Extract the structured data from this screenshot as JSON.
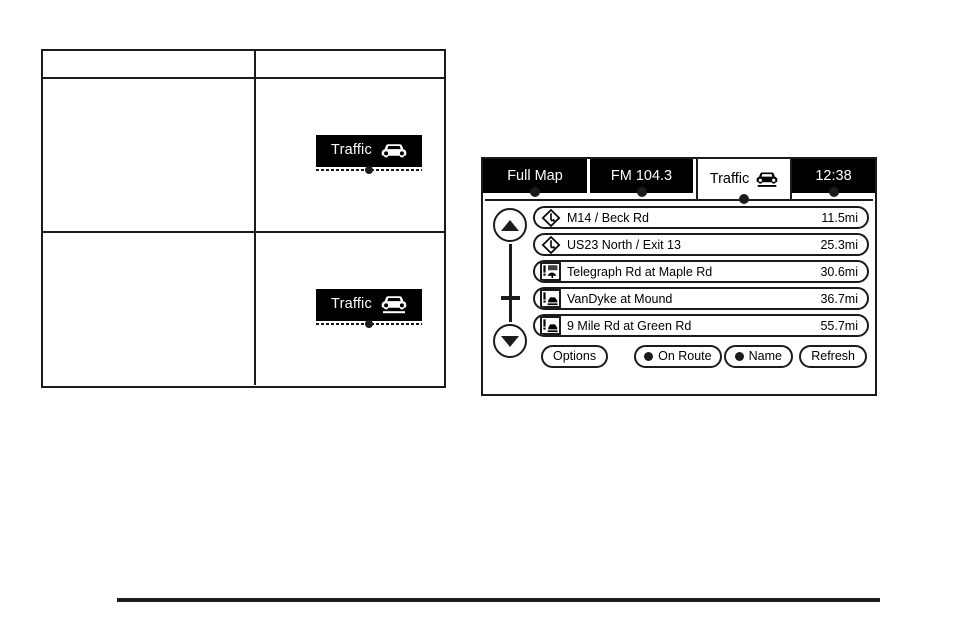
{
  "left_table": {
    "header": {
      "col1": "",
      "col2": ""
    },
    "rows": [
      {
        "col1": "",
        "badge": {
          "label": "Traffic",
          "icon": "car-icon",
          "state": "no-underline"
        }
      },
      {
        "col1": "",
        "badge": {
          "label": "Traffic",
          "icon": "car-road-icon",
          "state": "underline"
        }
      }
    ]
  },
  "nav_screen": {
    "tabs": [
      {
        "label": "Full Map",
        "name": "tab-full-map",
        "active": false
      },
      {
        "label": "FM 104.3",
        "name": "tab-fm-radio",
        "active": false
      },
      {
        "label": "Traffic",
        "name": "tab-traffic",
        "active": true,
        "icon": "car-road-icon"
      },
      {
        "label": "12:38",
        "name": "tab-clock",
        "active": false
      }
    ],
    "scroll": {
      "up_icon": "triangle-up-icon",
      "down_icon": "triangle-down-icon"
    },
    "list": [
      {
        "icon": "diamond-arrow-icon",
        "name": "M14 / Beck Rd",
        "distance": "11.5mi"
      },
      {
        "icon": "diamond-arrow-icon",
        "name": "US23 North / Exit 13",
        "distance": "25.3mi"
      },
      {
        "icon": "construction-icon",
        "name": "Telegraph Rd at Maple Rd",
        "distance": "30.6mi"
      },
      {
        "icon": "accident-icon",
        "name": "VanDyke at Mound",
        "distance": "36.7mi"
      },
      {
        "icon": "accident-icon",
        "name": "9 Mile Rd at Green Rd",
        "distance": "55.7mi"
      }
    ],
    "buttons": {
      "options": "Options",
      "on_route": "On Route",
      "name": "Name",
      "refresh": "Refresh"
    }
  },
  "colors": {
    "ink": "#1b1b1b",
    "black": "#000000",
    "white": "#ffffff"
  }
}
